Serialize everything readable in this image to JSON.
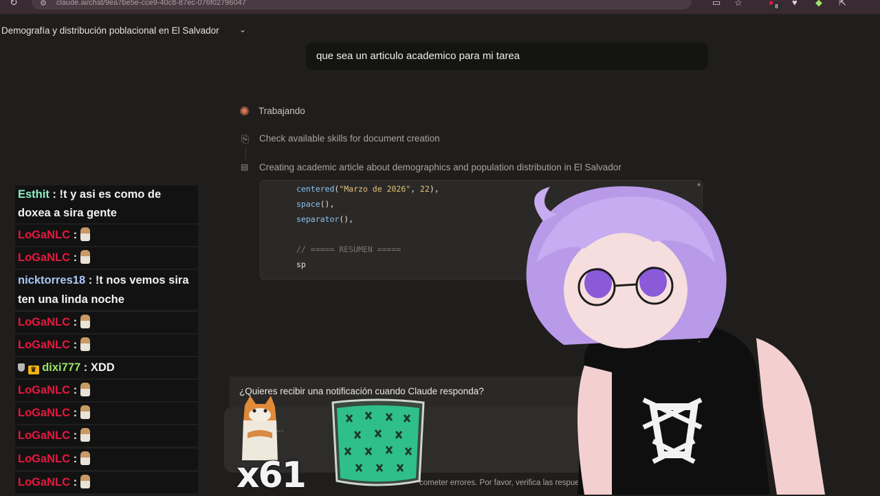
{
  "browser": {
    "url": "claude.ai/chat/9ea7be5e-cce9-40c8-87ec-076f02796047",
    "extension_badge": "8"
  },
  "chat": {
    "title": "Demografía y distribución poblacional en El Salvador",
    "user_message": "que sea un articulo academico para mi tarea",
    "status": "Trabajando",
    "steps": [
      {
        "label": "Check available skills for document creation"
      },
      {
        "label": "Creating academic article about demographics and population distribution in El Salvador"
      }
    ],
    "code": {
      "line1_fn": "centered",
      "line1_str": "\"Marzo de 2026\"",
      "line1_num": "22",
      "line2_fn": "space",
      "line3_fn": "separator",
      "line4_comment": "// ===== RESUMEN =====",
      "line5": "sp"
    },
    "notification_prompt": "¿Quieres recibir una notificación cuando Claude responda?",
    "input_placeholder": "r...",
    "disclaimer": "cometer errores. Por favor, verifica las respue"
  },
  "stream_chat": {
    "messages": [
      {
        "user": "Esthit",
        "color": "#8ff0c3",
        "text": "!t y asi es como de",
        "text2": "doxea a sira gente"
      },
      {
        "user": "LoGaNLC",
        "color": "#e8173f",
        "emote": "cat"
      },
      {
        "user": "LoGaNLC",
        "color": "#e8173f",
        "emote": "cat"
      },
      {
        "user": "nicktorres18",
        "color": "#a9c9f5",
        "text": "!t nos vemos sira",
        "text2": "ten una linda noche"
      },
      {
        "user": "LoGaNLC",
        "color": "#e8173f",
        "emote": "cat"
      },
      {
        "user": "LoGaNLC",
        "color": "#e8173f",
        "emote": "cat"
      },
      {
        "user": "dixi777",
        "color": "#9be36c",
        "text": "XDD"
      },
      {
        "user": "LoGaNLC",
        "color": "#e8173f",
        "emote": "cat"
      },
      {
        "user": "LoGaNLC",
        "color": "#e8173f",
        "emote": "cat"
      },
      {
        "user": "LoGaNLC",
        "color": "#e8173f",
        "emote": "cat"
      },
      {
        "user": "LoGaNLC",
        "color": "#e8173f",
        "emote": "cat"
      },
      {
        "user": "LoGaNLC",
        "color": "#e8173f",
        "emote": "cat"
      }
    ]
  },
  "overlay": {
    "combo": "x61"
  },
  "icons": {
    "reload": "reload-icon",
    "status": "sparkle-icon",
    "step1": "document-icon",
    "step2": "js-file-icon"
  },
  "colors": {
    "accent": "#d97757",
    "background": "#1f1e1d"
  }
}
